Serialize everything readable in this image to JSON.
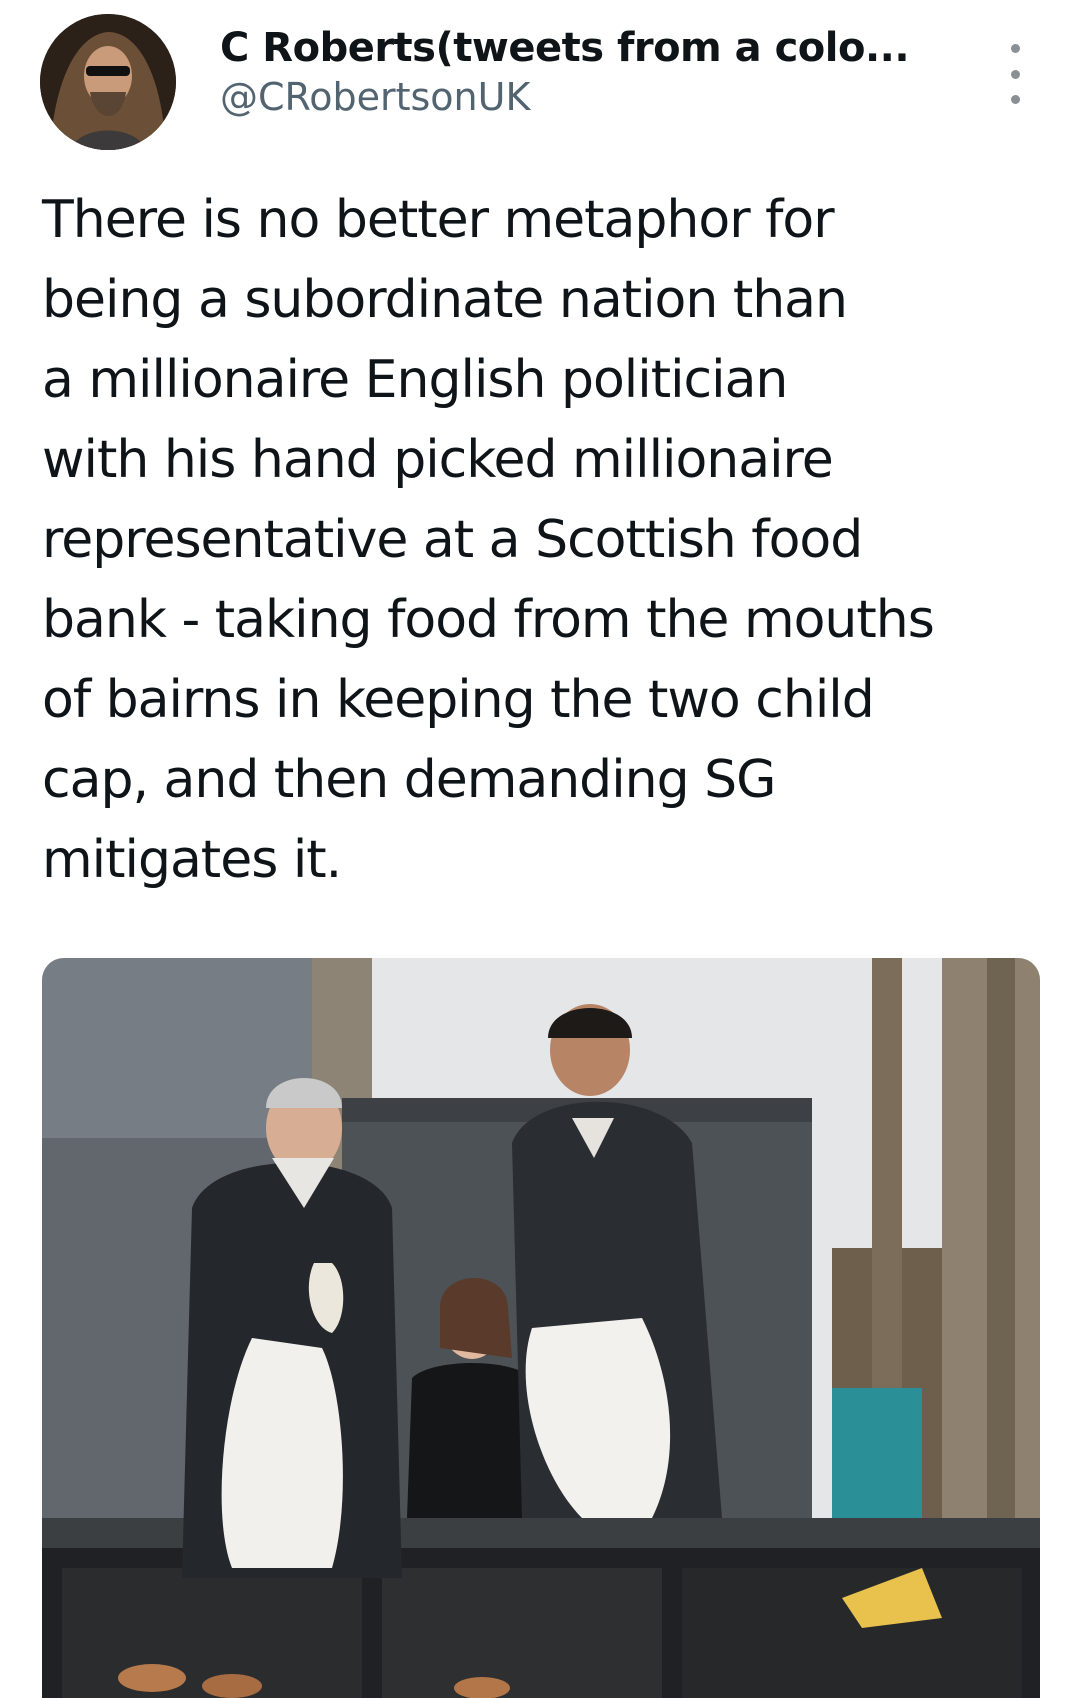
{
  "tweet": {
    "author": {
      "display_name": "C Roberts(tweets from a colo...",
      "handle": "@CRobertsonUK",
      "avatar_icon": "profile-avatar"
    },
    "more_icon": "more-options-icon",
    "text_lines": [
      "There is no better metaphor for",
      "being a subordinate nation than",
      "a millionaire English politician",
      "with his hand picked millionaire",
      "representative at a Scottish food",
      "bank - taking food from the mouths",
      "of bairns in keeping the two child",
      "cap, and then demanding SG",
      "mitigates it."
    ],
    "media": {
      "type": "photo"
    }
  }
}
